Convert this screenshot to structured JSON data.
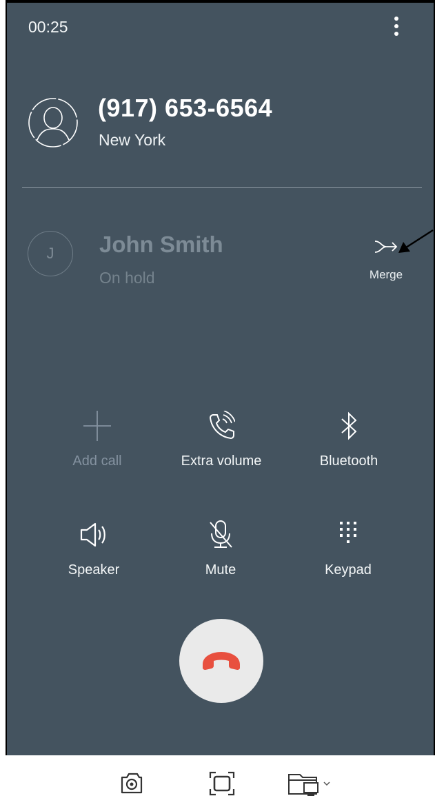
{
  "status": {
    "time": "00:25",
    "menu_icon": "more-vert-icon"
  },
  "active_call": {
    "number": "(917) 653-6564",
    "location": "New York",
    "avatar_icon": "contact-avatar-icon"
  },
  "held_call": {
    "initial": "J",
    "name": "John Smith",
    "status": "On hold",
    "merge_label": "Merge",
    "merge_icon": "merge-icon"
  },
  "controls": [
    {
      "label": "Add call",
      "icon": "add-icon",
      "enabled": false
    },
    {
      "label": "Extra volume",
      "icon": "extra-volume-icon",
      "enabled": true
    },
    {
      "label": "Bluetooth",
      "icon": "bluetooth-icon",
      "enabled": true
    },
    {
      "label": "Speaker",
      "icon": "speaker-icon",
      "enabled": true
    },
    {
      "label": "Mute",
      "icon": "mic-off-icon",
      "enabled": true
    },
    {
      "label": "Keypad",
      "icon": "dialpad-icon",
      "enabled": true
    }
  ],
  "end_call": {
    "icon": "end-call-icon",
    "color": "#e8503f"
  },
  "colors": {
    "background": "#44535f",
    "text": "#ffffff",
    "disabled": "#7d8b96"
  },
  "bottom_bar": {
    "icons": [
      "camera-icon",
      "screenshot-frame-icon",
      "screen-mirror-icon"
    ]
  }
}
